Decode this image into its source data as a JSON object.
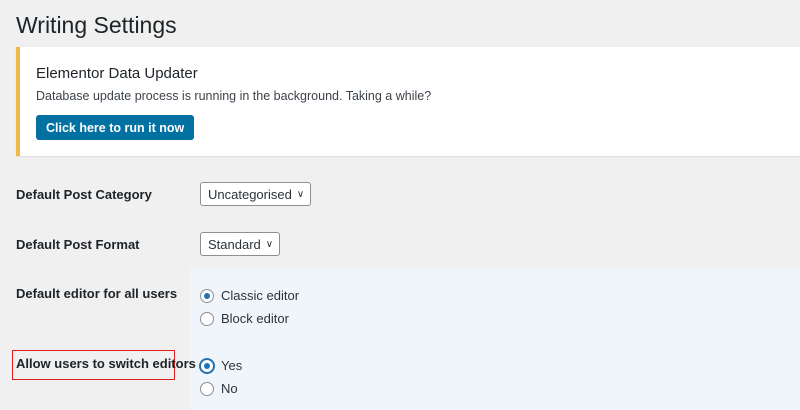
{
  "page_title": "Writing Settings",
  "notice": {
    "title": "Elementor Data Updater",
    "message": "Database update process is running in the background. Taking a while?",
    "button": "Click here to run it now"
  },
  "settings": {
    "category": {
      "label": "Default Post Category",
      "value": "Uncategorised"
    },
    "format": {
      "label": "Default Post Format",
      "value": "Standard"
    },
    "editor": {
      "label": "Default editor for all users",
      "options": [
        "Classic editor",
        "Block editor"
      ],
      "selected": "Classic editor"
    },
    "switch": {
      "label": "Allow users to switch editors",
      "options": [
        "Yes",
        "No"
      ],
      "selected": "Yes"
    }
  },
  "colors": {
    "accent": "#2271b1",
    "notice_border": "#f0b849",
    "button": "#0071a1",
    "highlight": "#e02020"
  }
}
